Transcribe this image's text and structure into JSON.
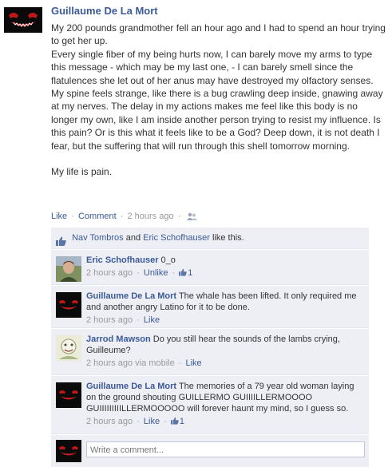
{
  "post": {
    "author": "Guillaume De La Mort",
    "message_paragraphs": [
      "My 200 pounds grandmother fell an hour ago and I had to spend an hour trying to get her up.",
      "Every single fiber of my being hurts now, I can barely move my arms to type this message - which may be my last one, - I can barely smell since the flatulences she let out of her anus may have destroyed my olfactory senses. My spine feels strange, like there is a bug crawling deep inside, gnawing away at my nerves. The delay in my actions makes me feel like this body is no longer my own, like I am inside another person trying to resist my influence. Is this pain? Or is this what it feels like to be a God? Deep down, it is not death I fear, but the suffering that will run through this shell tomorrow morning.",
      "My life is pain."
    ],
    "actions": {
      "like": "Like",
      "comment": "Comment",
      "time": "2 hours ago",
      "separator": "·"
    }
  },
  "likes": {
    "person1": "Nav Tombros",
    "and": " and ",
    "person2": "Eric Schofhauser",
    "suffix": " like this."
  },
  "comments": [
    {
      "name": "Eric Schofhauser",
      "text": "0_o",
      "time": "2 hours ago",
      "action": "Unlike",
      "like_count": "1",
      "via": ""
    },
    {
      "name": "Guillaume De La Mort",
      "text": "The whale has been lifted. It only required me and another angry Latino for it to be done.",
      "time": "2 hours ago",
      "action": "Like",
      "like_count": "",
      "via": ""
    },
    {
      "name": "Jarrod Mawson",
      "text": "Do you still hear the sounds of the lambs crying, Guilleume?",
      "time": "2 hours ago",
      "action": "Like",
      "like_count": "",
      "via": "via mobile"
    },
    {
      "name": "Guillaume De La Mort",
      "text": "The memories of a 79 year old woman laying on the ground shouting GUILLERMO GUIIIILLERMOOOO GUIIIIIIIIILLERMOOOOO will forever haunt my mind, so I guess so.",
      "time": "2 hours ago",
      "action": "Like",
      "like_count": "1",
      "via": ""
    }
  ],
  "write_comment": {
    "placeholder": "Write a comment..."
  },
  "icons": {
    "people": "people-icon",
    "thumb": "thumbs-up-icon"
  },
  "colors": {
    "link": "#3b5998",
    "feedback_bg": "#edeff4",
    "meta": "#999999"
  }
}
